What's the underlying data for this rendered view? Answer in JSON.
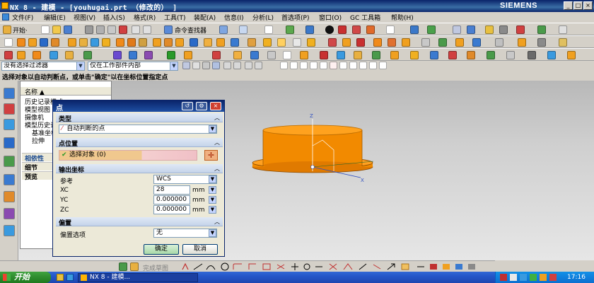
{
  "window": {
    "title": "NX 8 - 建模 - [youhugai.prt （修改的） ]",
    "brand": "SIEMENS",
    "controls": [
      "_",
      "□",
      "×"
    ]
  },
  "menubar": {
    "items": [
      "文件(F)",
      "编辑(E)",
      "视图(V)",
      "插入(S)",
      "格式(R)",
      "工具(T)",
      "装配(A)",
      "信息(I)",
      "分析(L)",
      "首选项(P)",
      "窗口(O)",
      "GC 工具箱",
      "帮助(H)"
    ]
  },
  "toolbar1": {
    "start_label": "开始·",
    "command_finder": "命令查找器"
  },
  "filterbar": {
    "type_filter": "没有选择过滤器",
    "scope_filter": "仅在工作部件内部"
  },
  "cue_line": "选择对象以自动判断点，或单击\"确定\"以在坐标位置指定点",
  "navigator": {
    "column_header": "名称 ▲",
    "rows": [
      "历史记录模式",
      "模型视图",
      "摄像机",
      "模型历史记录",
      "基准坐标系",
      "拉伸"
    ],
    "sections": [
      "相依性",
      "细节",
      "预览"
    ]
  },
  "dialog": {
    "title": "点",
    "groups": {
      "type": "类型",
      "location": "点位置",
      "output": "输出坐标",
      "offset": "偏置"
    },
    "type_value": "自动判断的点",
    "select_object": "选择对象 (0)",
    "reference_label": "参考",
    "reference_value": "WCS",
    "xc_label": "XC",
    "xc_value": "28",
    "yc_label": "YC",
    "yc_value": "0.000000",
    "zc_label": "ZC",
    "zc_value": "0.000000",
    "unit": "mm",
    "offset_option_label": "偏置选项",
    "offset_option_value": "无",
    "ok": "确定",
    "cancel": "取消"
  },
  "sketchbar": {
    "label": "完成草图"
  },
  "taskbar": {
    "start": "开始",
    "task": "NX 8 - 建模...",
    "clock": "17:16"
  },
  "colors": {
    "part_face": "#ff9a1a",
    "part_side": "#f28a00",
    "titlebar": "#0a246a",
    "taskbar": "#2456c8"
  }
}
